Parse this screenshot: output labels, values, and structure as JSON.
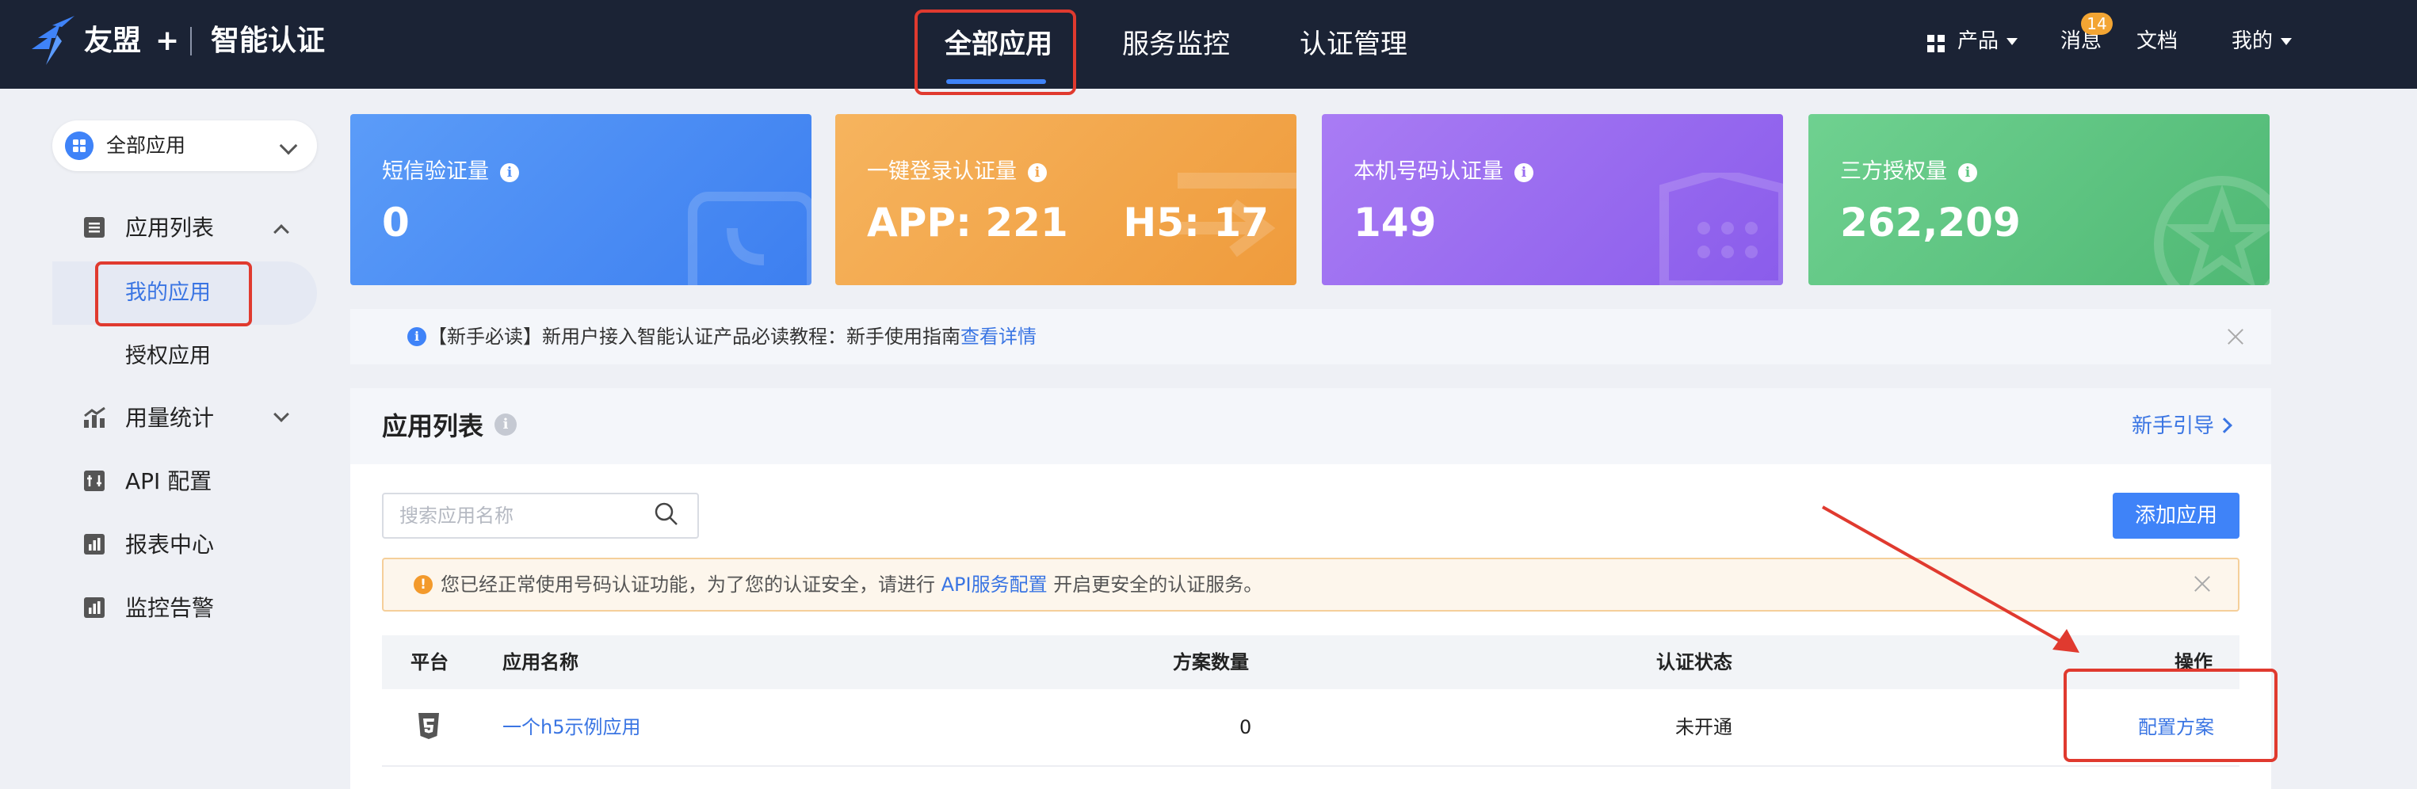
{
  "header": {
    "brand": "友盟",
    "plus": "+",
    "product": "智能认证",
    "nav": [
      "全部应用",
      "服务监控",
      "认证管理"
    ],
    "products_label": "产品",
    "messages_label": "消息",
    "messages_badge": "14",
    "docs_label": "文档",
    "me_label": "我的"
  },
  "sidebar": {
    "app_selector": "全部应用",
    "menu": {
      "app_list": "应用列表",
      "my_apps": "我的应用",
      "authorized_apps": "授权应用",
      "usage_stats": "用量统计",
      "api_config": "API 配置",
      "reports": "报表中心",
      "alerts": "监控告警"
    }
  },
  "cards": [
    {
      "label": "短信验证量",
      "value": "0",
      "color": "#4d8ef6"
    },
    {
      "label": "一键登录认证量",
      "value": "APP: 221    H5: 17",
      "color": "#f2a44b"
    },
    {
      "label": "本机号码认证量",
      "value": "149",
      "color": "#9b6ef0"
    },
    {
      "label": "三方授权量",
      "value": "262,209",
      "color": "#5cc47f"
    }
  ],
  "notice": {
    "text": "【新手必读】新用户接入智能认证产品必读教程：新手使用指南",
    "link": "查看详情"
  },
  "app_list": {
    "title": "应用列表",
    "guide_link": "新手引导",
    "search_placeholder": "搜索应用名称",
    "add_button": "添加应用",
    "warning": {
      "before": "您已经正常使用号码认证功能，为了您的认证安全，请进行 ",
      "link": "API服务配置",
      "after": " 开启更安全的认证服务。"
    },
    "columns": {
      "platform": "平台",
      "name": "应用名称",
      "plans": "方案数量",
      "status": "认证状态",
      "actions": "操作"
    },
    "rows": [
      {
        "platform_icon": "html5-icon",
        "name": "一个h5示例应用",
        "plans": "0",
        "status": "未开通",
        "action": "配置方案"
      }
    ]
  }
}
